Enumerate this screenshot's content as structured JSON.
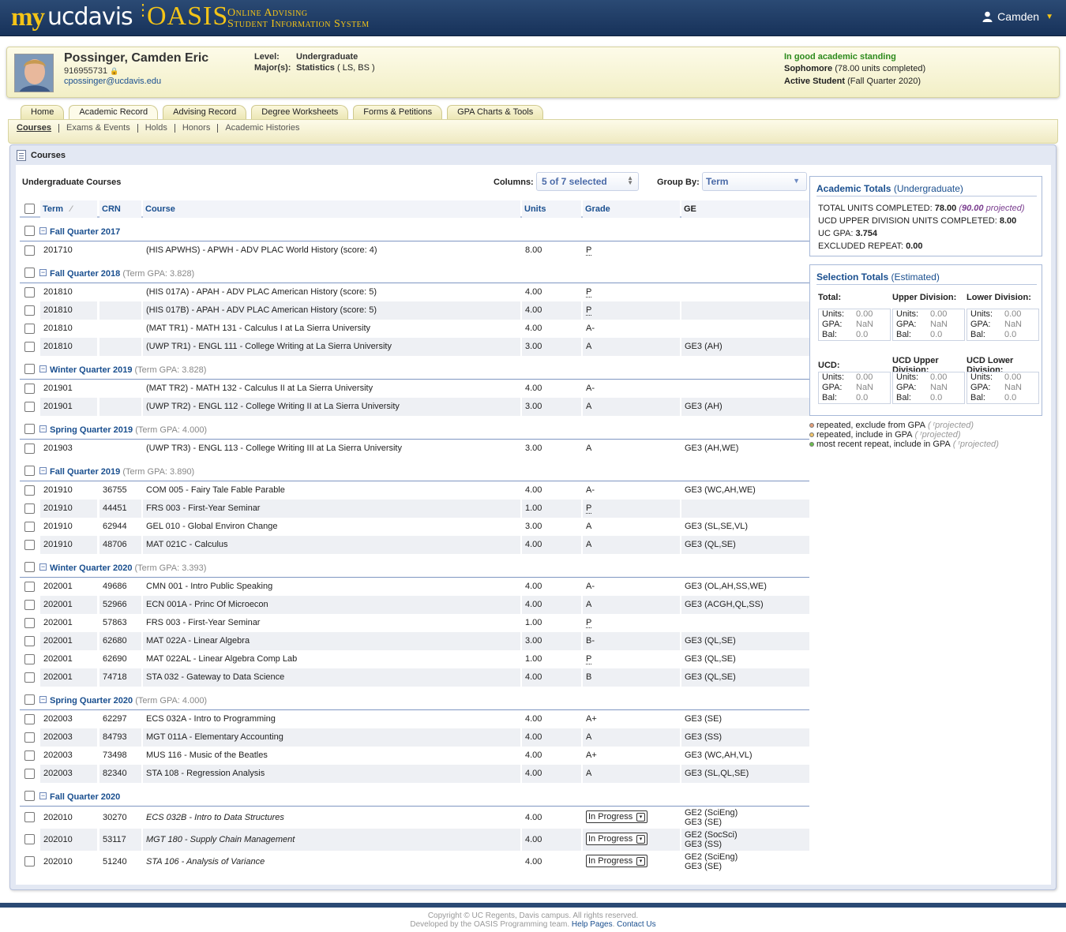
{
  "header": {
    "logo_my": "my",
    "logo_ucdavis": "ucdavis",
    "logo_oasis": "OASIS",
    "logo_sub_1": "Online Advising",
    "logo_sub_2": "Student Information System",
    "user_name": "Camden",
    "icons": {
      "user": "user-icon",
      "caret": "chevron-down-icon"
    }
  },
  "profile": {
    "name": "Possinger, Camden Eric",
    "student_id": "916955731",
    "email": "cpossinger@ucdavis.edu",
    "level_label": "Level:",
    "level_value": "Undergraduate",
    "majors_label": "Major(s):",
    "major_value": "Statistics",
    "major_codes": "( LS, BS )",
    "standing": "In good academic standing",
    "class_level": "Sophomore",
    "class_units": "(78.00 units completed)",
    "status": "Active Student",
    "status_term": "(Fall Quarter 2020)"
  },
  "tabs": [
    "Home",
    "Academic Record",
    "Advising Record",
    "Degree Worksheets",
    "Forms & Petitions",
    "GPA Charts & Tools"
  ],
  "active_tab": "Academic Record",
  "subnav": [
    "Courses",
    "Exams & Events",
    "Holds",
    "Honors",
    "Academic Histories"
  ],
  "panel": {
    "title": "Courses"
  },
  "table": {
    "title": "Undergraduate Courses",
    "columns_label": "Columns:",
    "columns_value": "5 of 7 selected",
    "group_label": "Group By:",
    "group_value": "Term",
    "headers": {
      "term": "Term",
      "crn": "CRN",
      "course": "Course",
      "units": "Units",
      "grade": "Grade",
      "ge": "GE"
    },
    "groups": [
      {
        "name": "Fall Quarter 2017",
        "gpa": "",
        "rows": [
          {
            "term": "201710",
            "crn": "",
            "course": "(HIS APWHS) - APWH - ADV PLAC World History (score: 4)",
            "units": "8.00",
            "grade": "P",
            "ge": ""
          }
        ]
      },
      {
        "name": "Fall Quarter 2018",
        "gpa": "(Term GPA: 3.828)",
        "rows": [
          {
            "term": "201810",
            "crn": "",
            "course": "(HIS 017A) - APAH - ADV PLAC American History (score: 5)",
            "units": "4.00",
            "grade": "P",
            "ge": ""
          },
          {
            "term": "201810",
            "crn": "",
            "course": "(HIS 017B) - APAH - ADV PLAC American History (score: 5)",
            "units": "4.00",
            "grade": "P",
            "ge": ""
          },
          {
            "term": "201810",
            "crn": "",
            "course": "(MAT TR1) - MATH 131 - Calculus I at La Sierra University",
            "units": "4.00",
            "grade": "A-",
            "ge": ""
          },
          {
            "term": "201810",
            "crn": "",
            "course": "(UWP TR1) - ENGL 111 - College Writing at La Sierra University",
            "units": "3.00",
            "grade": "A",
            "ge": "GE3 (AH)"
          }
        ]
      },
      {
        "name": "Winter Quarter 2019",
        "gpa": "(Term GPA: 3.828)",
        "rows": [
          {
            "term": "201901",
            "crn": "",
            "course": "(MAT TR2) - MATH 132 - Calculus II at La Sierra University",
            "units": "4.00",
            "grade": "A-",
            "ge": ""
          },
          {
            "term": "201901",
            "crn": "",
            "course": "(UWP TR2) - ENGL 112 - College Writing II at La Sierra University",
            "units": "3.00",
            "grade": "A",
            "ge": "GE3 (AH)"
          }
        ]
      },
      {
        "name": "Spring Quarter 2019",
        "gpa": "(Term GPA: 4.000)",
        "rows": [
          {
            "term": "201903",
            "crn": "",
            "course": "(UWP TR3) - ENGL 113 - College Writing III at La Sierra University",
            "units": "3.00",
            "grade": "A",
            "ge": "GE3 (AH,WE)"
          }
        ]
      },
      {
        "name": "Fall Quarter 2019",
        "gpa": "(Term GPA: 3.890)",
        "rows": [
          {
            "term": "201910",
            "crn": "36755",
            "course": "COM 005 - Fairy Tale Fable Parable",
            "units": "4.00",
            "grade": "A-",
            "ge": "GE3 (WC,AH,WE)"
          },
          {
            "term": "201910",
            "crn": "44451",
            "course": "FRS 003 - First-Year Seminar",
            "units": "1.00",
            "grade": "P",
            "ge": ""
          },
          {
            "term": "201910",
            "crn": "62944",
            "course": "GEL 010 - Global Environ Change",
            "units": "3.00",
            "grade": "A",
            "ge": "GE3 (SL,SE,VL)"
          },
          {
            "term": "201910",
            "crn": "48706",
            "course": "MAT 021C - Calculus",
            "units": "4.00",
            "grade": "A",
            "ge": "GE3 (QL,SE)"
          }
        ]
      },
      {
        "name": "Winter Quarter 2020",
        "gpa": "(Term GPA: 3.393)",
        "rows": [
          {
            "term": "202001",
            "crn": "49686",
            "course": "CMN 001 - Intro Public Speaking",
            "units": "4.00",
            "grade": "A-",
            "ge": "GE3 (OL,AH,SS,WE)"
          },
          {
            "term": "202001",
            "crn": "52966",
            "course": "ECN 001A - Princ Of Microecon",
            "units": "4.00",
            "grade": "A",
            "ge": "GE3 (ACGH,QL,SS)"
          },
          {
            "term": "202001",
            "crn": "57863",
            "course": "FRS 003 - First-Year Seminar",
            "units": "1.00",
            "grade": "P",
            "ge": ""
          },
          {
            "term": "202001",
            "crn": "62680",
            "course": "MAT 022A - Linear Algebra",
            "units": "3.00",
            "grade": "B-",
            "ge": "GE3 (QL,SE)"
          },
          {
            "term": "202001",
            "crn": "62690",
            "course": "MAT 022AL - Linear Algebra Comp Lab",
            "units": "1.00",
            "grade": "P",
            "ge": "GE3 (QL,SE)"
          },
          {
            "term": "202001",
            "crn": "74718",
            "course": "STA 032 - Gateway to Data Science",
            "units": "4.00",
            "grade": "B",
            "ge": "GE3 (QL,SE)"
          }
        ]
      },
      {
        "name": "Spring Quarter 2020",
        "gpa": "(Term GPA: 4.000)",
        "rows": [
          {
            "term": "202003",
            "crn": "62297",
            "course": "ECS 032A - Intro to Programming",
            "units": "4.00",
            "grade": "A+",
            "ge": "GE3 (SE)"
          },
          {
            "term": "202003",
            "crn": "84793",
            "course": "MGT 011A - Elementary Accounting",
            "units": "4.00",
            "grade": "A",
            "ge": "GE3 (SS)"
          },
          {
            "term": "202003",
            "crn": "73498",
            "course": "MUS 116 - Music of the Beatles",
            "units": "4.00",
            "grade": "A+",
            "ge": "GE3 (WC,AH,VL)"
          },
          {
            "term": "202003",
            "crn": "82340",
            "course": "STA 108 - Regression Analysis",
            "units": "4.00",
            "grade": "A",
            "ge": "GE3 (SL,QL,SE)"
          }
        ]
      },
      {
        "name": "Fall Quarter 2020",
        "gpa": "",
        "rows": [
          {
            "term": "202010",
            "crn": "30270",
            "course": "ECS 032B - Intro to Data Structures",
            "units": "4.00",
            "grade": "In Progress",
            "ge": "GE2 (SciEng)",
            "ge2": "GE3 (SE)",
            "in_progress": true
          },
          {
            "term": "202010",
            "crn": "53117",
            "course": "MGT 180 - Supply Chain Management",
            "units": "4.00",
            "grade": "In Progress",
            "ge": "GE2 (SocSci)",
            "ge2": "GE3 (SS)",
            "in_progress": true
          },
          {
            "term": "202010",
            "crn": "51240",
            "course": "STA 106 - Analysis of Variance",
            "units": "4.00",
            "grade": "In Progress",
            "ge": "GE2 (SciEng)",
            "ge2": "GE3 (SE)",
            "in_progress": true
          }
        ]
      }
    ]
  },
  "academic_totals": {
    "title": "Academic Totals",
    "subtitle": "(Undergraduate)",
    "total_units_label": "TOTAL UNITS COMPLETED:",
    "total_units": "78.00",
    "projected_value": "90.00",
    "projected_word": "projected",
    "upper_div_label": "UCD UPPER DIVISION UNITS COMPLETED:",
    "upper_div": "8.00",
    "gpa_label": "UC GPA:",
    "gpa": "3.754",
    "excluded_label": "EXCLUDED REPEAT:",
    "excluded": "0.00"
  },
  "selection_totals": {
    "title": "Selection Totals",
    "subtitle": "(Estimated)",
    "groups": [
      {
        "label": "Total:",
        "units": "0.00",
        "gpa": "NaN",
        "bal": "0.0"
      },
      {
        "label": "Upper Division:",
        "units": "0.00",
        "gpa": "NaN",
        "bal": "0.0"
      },
      {
        "label": "Lower Division:",
        "units": "0.00",
        "gpa": "NaN",
        "bal": "0.0"
      },
      {
        "label": "UCD:",
        "units": "0.00",
        "gpa": "NaN",
        "bal": "0.0"
      },
      {
        "label": "UCD Upper Division:",
        "units": "0.00",
        "gpa": "NaN",
        "bal": "0.0"
      },
      {
        "label": "UCD Lower Division:",
        "units": "0.00",
        "gpa": "NaN",
        "bal": "0.0"
      }
    ],
    "keys": {
      "units": "Units:",
      "gpa": "GPA:",
      "bal": "Bal:"
    }
  },
  "legend": [
    {
      "text": "repeated, exclude from GPA",
      "color": "#e5a07a"
    },
    {
      "text": "repeated, include in GPA",
      "color": "#f2c56a"
    },
    {
      "text": "most recent repeat, include in GPA",
      "color": "#6bbf4e"
    }
  ],
  "legend_projected": "projected",
  "footer": {
    "copyright": "Copyright © UC Regents, Davis campus. All rights reserved.",
    "developed": "Developed by the OASIS Programming team.",
    "help": "Help Pages",
    "contact": "Contact Us"
  }
}
